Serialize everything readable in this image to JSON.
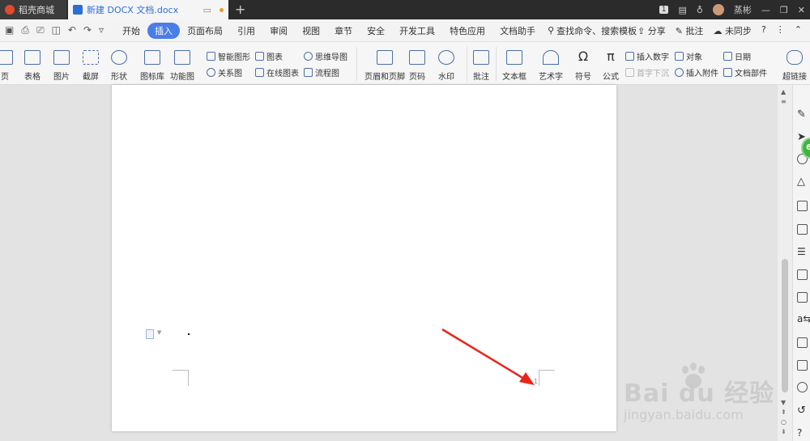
{
  "tabs": {
    "store": "稻壳商城",
    "doc": "新建 DOCX 文档.docx",
    "add": "+"
  },
  "window": {
    "badge": "1",
    "user": "蒸彬"
  },
  "menu": {
    "items": [
      "开始",
      "插入",
      "页面布局",
      "引用",
      "审阅",
      "视图",
      "章节",
      "安全",
      "开发工具",
      "特色应用",
      "文档助手"
    ],
    "active": "插入",
    "search": "查找命令、搜索模板",
    "share": "分享",
    "comment": "批注",
    "sync": "未同步",
    "help": "?"
  },
  "ribbon": {
    "page": "页",
    "table": "表格",
    "picture": "图片",
    "screenshot": "截屏",
    "shape": "形状",
    "iconlib": "图标库",
    "funcchart": "功能图",
    "smartart": "智能图形",
    "chart": "图表",
    "mindmap": "思维导图",
    "relation": "关系图",
    "onlinechart": "在线图表",
    "flowchart": "流程图",
    "headerfooter": "页眉和页脚",
    "pagenum": "页码",
    "watermark": "水印",
    "annotate": "批注",
    "textbox": "文本框",
    "wordart": "艺术字",
    "symbol": "符号",
    "formula": "公式",
    "insertnum": "插入数字",
    "dropcap": "首字下沉",
    "object": "对象",
    "attachment": "插入附件",
    "date": "日期",
    "docparts": "文档部件",
    "hyperlink": "超链接"
  },
  "page": {
    "page_number": "1"
  },
  "sidebar": {
    "badge": "6"
  },
  "watermark": {
    "logo": "Bai du 经验",
    "url": "jingyan.baidu.com"
  }
}
